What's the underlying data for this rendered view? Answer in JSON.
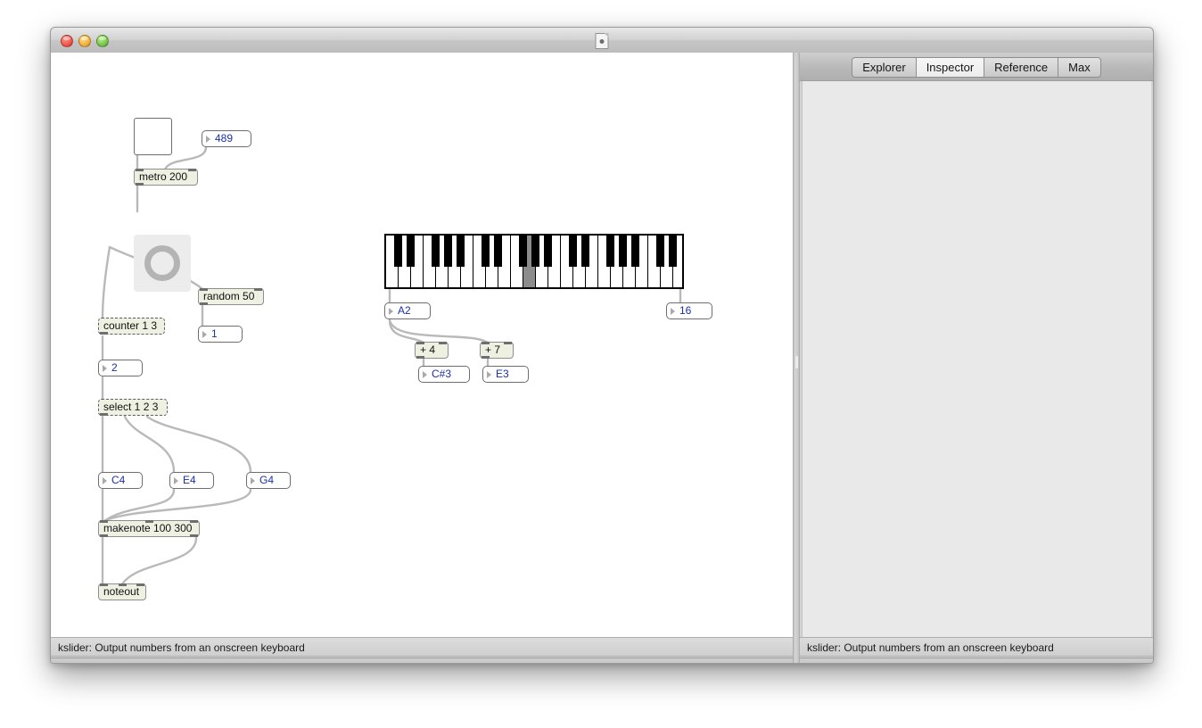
{
  "window": {
    "title": "",
    "doc_icon": "document-icon",
    "traffic_lights": [
      "close",
      "minimize",
      "zoom"
    ]
  },
  "patcher": {
    "status_text": "kslider: Output numbers from an onscreen keyboard",
    "objects": {
      "toggle": {
        "name": "toggle",
        "value": ""
      },
      "metro_arg_numbox": {
        "value": "489"
      },
      "metro": {
        "text": "metro 200"
      },
      "bang": {
        "name": "bang"
      },
      "random": {
        "text": "random 50"
      },
      "random_out_numbox": {
        "value": "1"
      },
      "counter": {
        "text": "counter 1 3"
      },
      "counter_out_numbox": {
        "value": "2"
      },
      "select": {
        "text": "select 1 2 3"
      },
      "msg_c4": {
        "value": "C4"
      },
      "msg_e4": {
        "value": "E4"
      },
      "msg_g4": {
        "value": "G4"
      },
      "makenote": {
        "text": "makenote 100 300"
      },
      "noteout": {
        "text": "noteout"
      },
      "kslider": {
        "name": "kslider",
        "active_note": "A2"
      },
      "kslider_pitch_numbox": {
        "value": "A2"
      },
      "kslider_velocity_numbox": {
        "value": "16"
      },
      "plus4": {
        "text": "+ 4"
      },
      "plus7": {
        "text": "+ 7"
      },
      "plus4_out_numbox": {
        "value": "C#3"
      },
      "plus7_out_numbox": {
        "value": "E3"
      }
    }
  },
  "left_toolbar": {
    "buttons": [
      {
        "icon": "lock-icon",
        "state": "dark"
      },
      {
        "icon": "layers-icon",
        "state": "dark"
      },
      {
        "icon": "binoculars-icon",
        "state": "dim"
      },
      {
        "icon": "close-x-icon",
        "state": "dim"
      },
      {
        "icon": "presentation-icon",
        "state": "dark"
      },
      {
        "icon": "info-icon",
        "state": "dim"
      },
      {
        "icon": "inspector-icon",
        "state": "dark"
      },
      {
        "icon": "grid-icon",
        "state": "dim"
      },
      {
        "icon": "gauge-icon",
        "state": "dim"
      }
    ],
    "layout_buttons": [
      {
        "icon": "panel-bottom-icon"
      },
      {
        "icon": "panel-side-icon"
      }
    ]
  },
  "sidepanel": {
    "tabs": [
      {
        "label": "Explorer",
        "selected": false
      },
      {
        "label": "Inspector",
        "selected": true
      },
      {
        "label": "Reference",
        "selected": false
      },
      {
        "label": "Max",
        "selected": false
      }
    ],
    "status_text": "kslider: Output numbers from an onscreen keyboard",
    "toolbar_buttons": [
      {
        "icon": "gear-dropdown-icon"
      },
      {
        "icon": "at-sign-icon"
      },
      {
        "icon": "list-icon"
      },
      {
        "icon": "snowflake-icon"
      },
      {
        "icon": "sunburst-icon"
      },
      {
        "icon": "plus-icon"
      },
      {
        "icon": "back-arrow-icon"
      }
    ]
  },
  "colors": {
    "object_fill": "#eef0e2",
    "numbox_text": "#1b2fa8",
    "cord_color": "#b9b9b9",
    "active_key": "#8c8c8c"
  }
}
